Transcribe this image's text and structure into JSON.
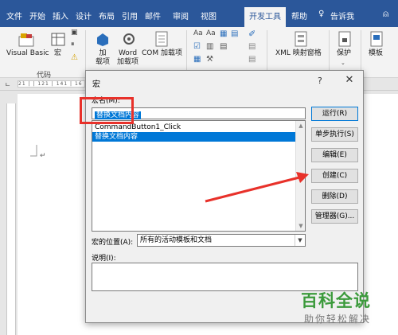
{
  "ribbon": {
    "tabs": [
      "文件",
      "开始",
      "插入",
      "设计",
      "布局",
      "引用",
      "邮件",
      "审阅",
      "视图",
      "开发工具",
      "帮助",
      "告诉我"
    ],
    "active_tab": "开发工具",
    "items": {
      "visual_basic": "Visual Basic",
      "macro": "宏",
      "addins": "加\n载项",
      "word_addins": "Word\n加载项",
      "com_addins": "COM 加载项",
      "xml_mapping": "XML 映射窗格",
      "protect": "保护",
      "template": "模板"
    },
    "group_code": "代码"
  },
  "dialog": {
    "title": "宏",
    "help": "?",
    "close": "✕",
    "macro_name_label": "宏名(M):",
    "macro_name_value": "替换文档内容",
    "macros": [
      "CommandButton1_Click",
      "替换文档内容"
    ],
    "selected_macro": "替换文档内容",
    "buttons": {
      "run": "运行(R)",
      "step": "单步执行(S)",
      "edit": "编辑(E)",
      "create": "创建(C)",
      "delete": "删除(D)",
      "organizer": "管理器(G)..."
    },
    "location_label": "宏的位置(A):",
    "location_value": "所有的活动模板和文档",
    "description_label": "说明(I):"
  },
  "ruler_text": "21 | | 121 | 141 | 16",
  "watermark": {
    "main": "百科全说",
    "sub": "助你轻松解决"
  },
  "colors": {
    "ribbon_blue": "#2b579a",
    "selection_blue": "#0078d7",
    "annotation_red": "#e8312a",
    "watermark_green": "#3b9a3b"
  }
}
